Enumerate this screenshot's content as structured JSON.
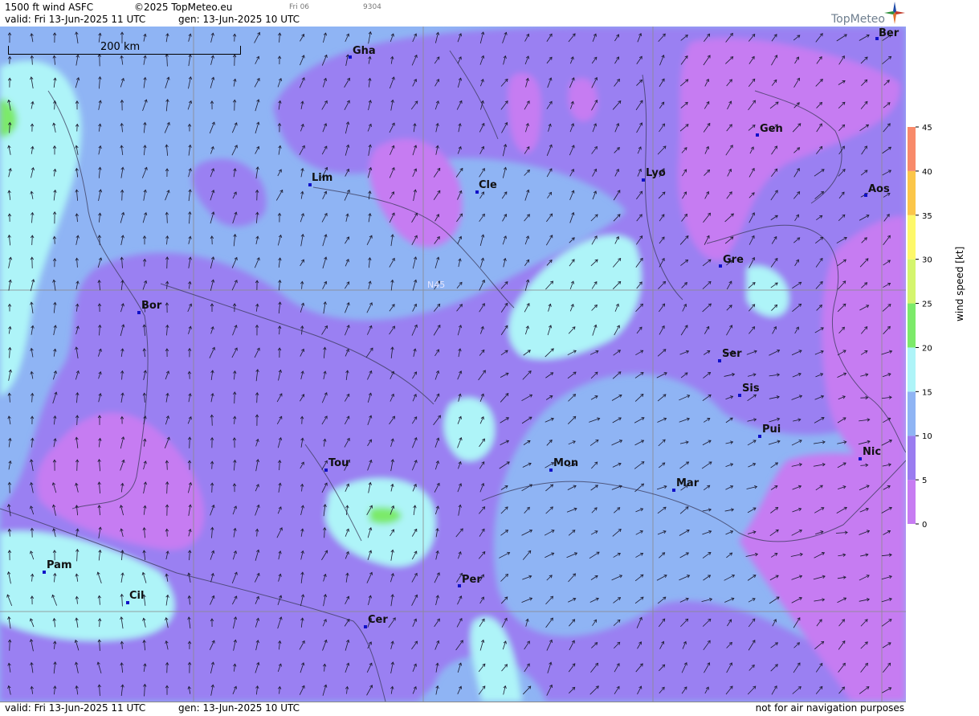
{
  "header": {
    "product": "1500 ft wind ASFC",
    "copyright": "©2025 TopMeteo.eu",
    "day_code": "Fri 06",
    "run_code": "9304",
    "valid": "valid:  Fri  13-Jun-2025  11 UTC",
    "gen": "gen: 13-Jun-2025 10 UTC"
  },
  "logo": {
    "text": "TopMeteo",
    "icon": "compass-star-icon"
  },
  "map": {
    "scale_label": "200 km",
    "latitude_label": "N45",
    "cities": [
      {
        "label": "Ber"
      },
      {
        "label": "Gha"
      },
      {
        "label": "Gen"
      },
      {
        "label": "Lim"
      },
      {
        "label": "Cle"
      },
      {
        "label": "Lyo"
      },
      {
        "label": "Aos"
      },
      {
        "label": "Gre"
      },
      {
        "label": "Bor"
      },
      {
        "label": "Ser"
      },
      {
        "label": "Sis"
      },
      {
        "label": "Pui"
      },
      {
        "label": "Nic"
      },
      {
        "label": "Tou"
      },
      {
        "label": "Mon"
      },
      {
        "label": "Mar"
      },
      {
        "label": "Pam"
      },
      {
        "label": "Cil"
      },
      {
        "label": "Per"
      },
      {
        "label": "Cer"
      }
    ]
  },
  "legend": {
    "title": "wind speed [kt]",
    "ticks": [
      "45",
      "40",
      "35",
      "30",
      "25",
      "20",
      "15",
      "10",
      "5",
      "0"
    ],
    "colors": [
      "#c77cf2",
      "#9a7cf0",
      "#8fb4f4",
      "#aef4f8",
      "#7cea6a",
      "#d4f56e",
      "#fdf86a",
      "#fbc64a",
      "#f88a6a"
    ]
  },
  "footer": {
    "valid": "valid:  Fri  13-Jun-2025  11 UTC",
    "gen": "gen: 13-Jun-2025 10 UTC",
    "disclaimer": "not for air navigation purposes"
  }
}
